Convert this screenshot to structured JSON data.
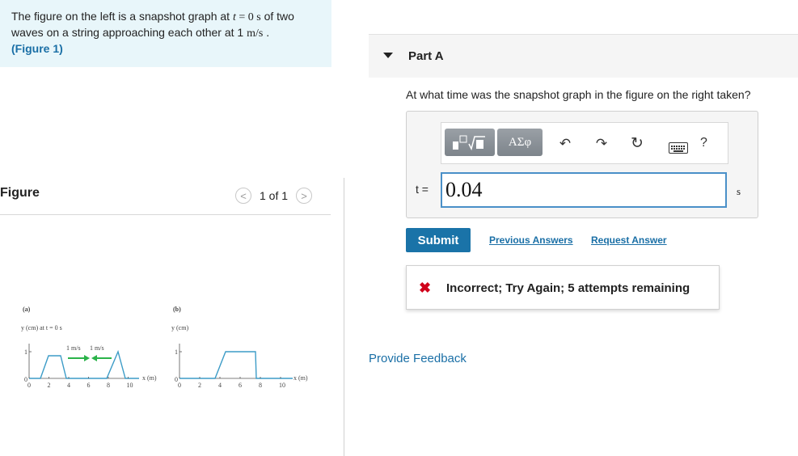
{
  "prompt": {
    "text1": "The figure on the left is a snapshot graph at ",
    "t_var": "t",
    "equals": " = ",
    "t_val": "0 s",
    "text2": " of two waves on a string approaching each other at 1 ",
    "speed_unit": "m/s",
    "text3": " .",
    "figure_link": "(Figure 1)"
  },
  "figure": {
    "label": "Figure",
    "pager": {
      "prev_icon": "chevron-left-icon",
      "text": "1 of 1",
      "next_icon": "chevron-right-icon"
    },
    "panel_a": {
      "tag": "(a)",
      "ylabel": "y (cm) at t = 0 s",
      "ytick": "1",
      "y0": "0",
      "xlabel": "x (m)",
      "xticks": [
        "0",
        "2",
        "4",
        "6",
        "8",
        "10"
      ],
      "speed_left": "1 m/s",
      "speed_right": "1 m/s"
    },
    "panel_b": {
      "tag": "(b)",
      "ylabel": "y (cm)",
      "ytick": "1",
      "y0": "0",
      "xlabel": "x (m)",
      "xticks": [
        "0",
        "2",
        "4",
        "6",
        "8",
        "10"
      ]
    },
    "colors": {
      "arrow": "#2bb34a",
      "curve": "#3d9cc7"
    }
  },
  "part_a": {
    "title": "Part A",
    "question": "At what time was the snapshot graph in the figure on the right taken?",
    "toolbar": {
      "templates_icon": "templates-icon",
      "greek_label": "ΑΣφ",
      "undo_icon": "↶",
      "redo_icon": "↷",
      "reset_icon": "↻",
      "keyboard_icon": "keyboard-icon",
      "help_label": "?"
    },
    "var_label": "t =",
    "answer_value": "0.04",
    "unit": "s",
    "submit_label": "Submit",
    "previous_answers_label": "Previous Answers",
    "request_answer_label": "Request Answer",
    "feedback_icon": "✖",
    "feedback_text": "Incorrect; Try Again; 5 attempts remaining"
  },
  "provide_feedback_label": "Provide Feedback"
}
